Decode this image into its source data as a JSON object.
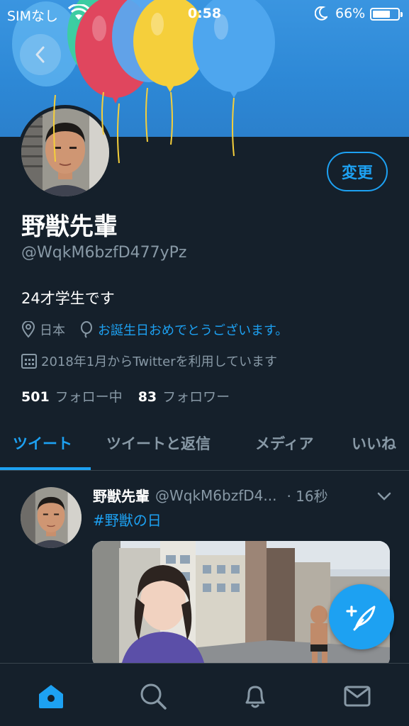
{
  "status_bar": {
    "carrier": "SIMなし",
    "time": "0:58",
    "battery": "66%"
  },
  "profile": {
    "edit_label": "変更",
    "display_name": "野獣先輩",
    "handle": "@WqkM6bzfD477yPz",
    "bio": "24才学生です",
    "location": "日本",
    "birthday_message": "お誕生日おめでとうございます。",
    "joined": "2018年1月からTwitterを利用しています",
    "following_count": "501",
    "following_label": "フォロー中",
    "followers_count": "83",
    "followers_label": "フォロワー"
  },
  "tabs": [
    {
      "label": "ツイート",
      "active": true
    },
    {
      "label": "ツイートと返信",
      "active": false
    },
    {
      "label": "メディア",
      "active": false
    },
    {
      "label": "いいね",
      "active": false
    }
  ],
  "tweet": {
    "name": "野獣先輩",
    "handle": "@WqkM6bzfD4...",
    "time": "· 16秒",
    "text": "#野獣の日"
  },
  "icons": {
    "back": "chevron-left-icon",
    "location": "location-pin-icon",
    "birthday": "balloon-icon",
    "joined": "calendar-icon",
    "compose": "compose-feather-icon",
    "nav": [
      "home-icon",
      "search-icon",
      "notifications-bell-icon",
      "messages-mail-icon"
    ]
  },
  "colors": {
    "background": "#15202b",
    "accent": "#1da1f2",
    "secondary_text": "#8899a6",
    "divider": "#38444d"
  }
}
